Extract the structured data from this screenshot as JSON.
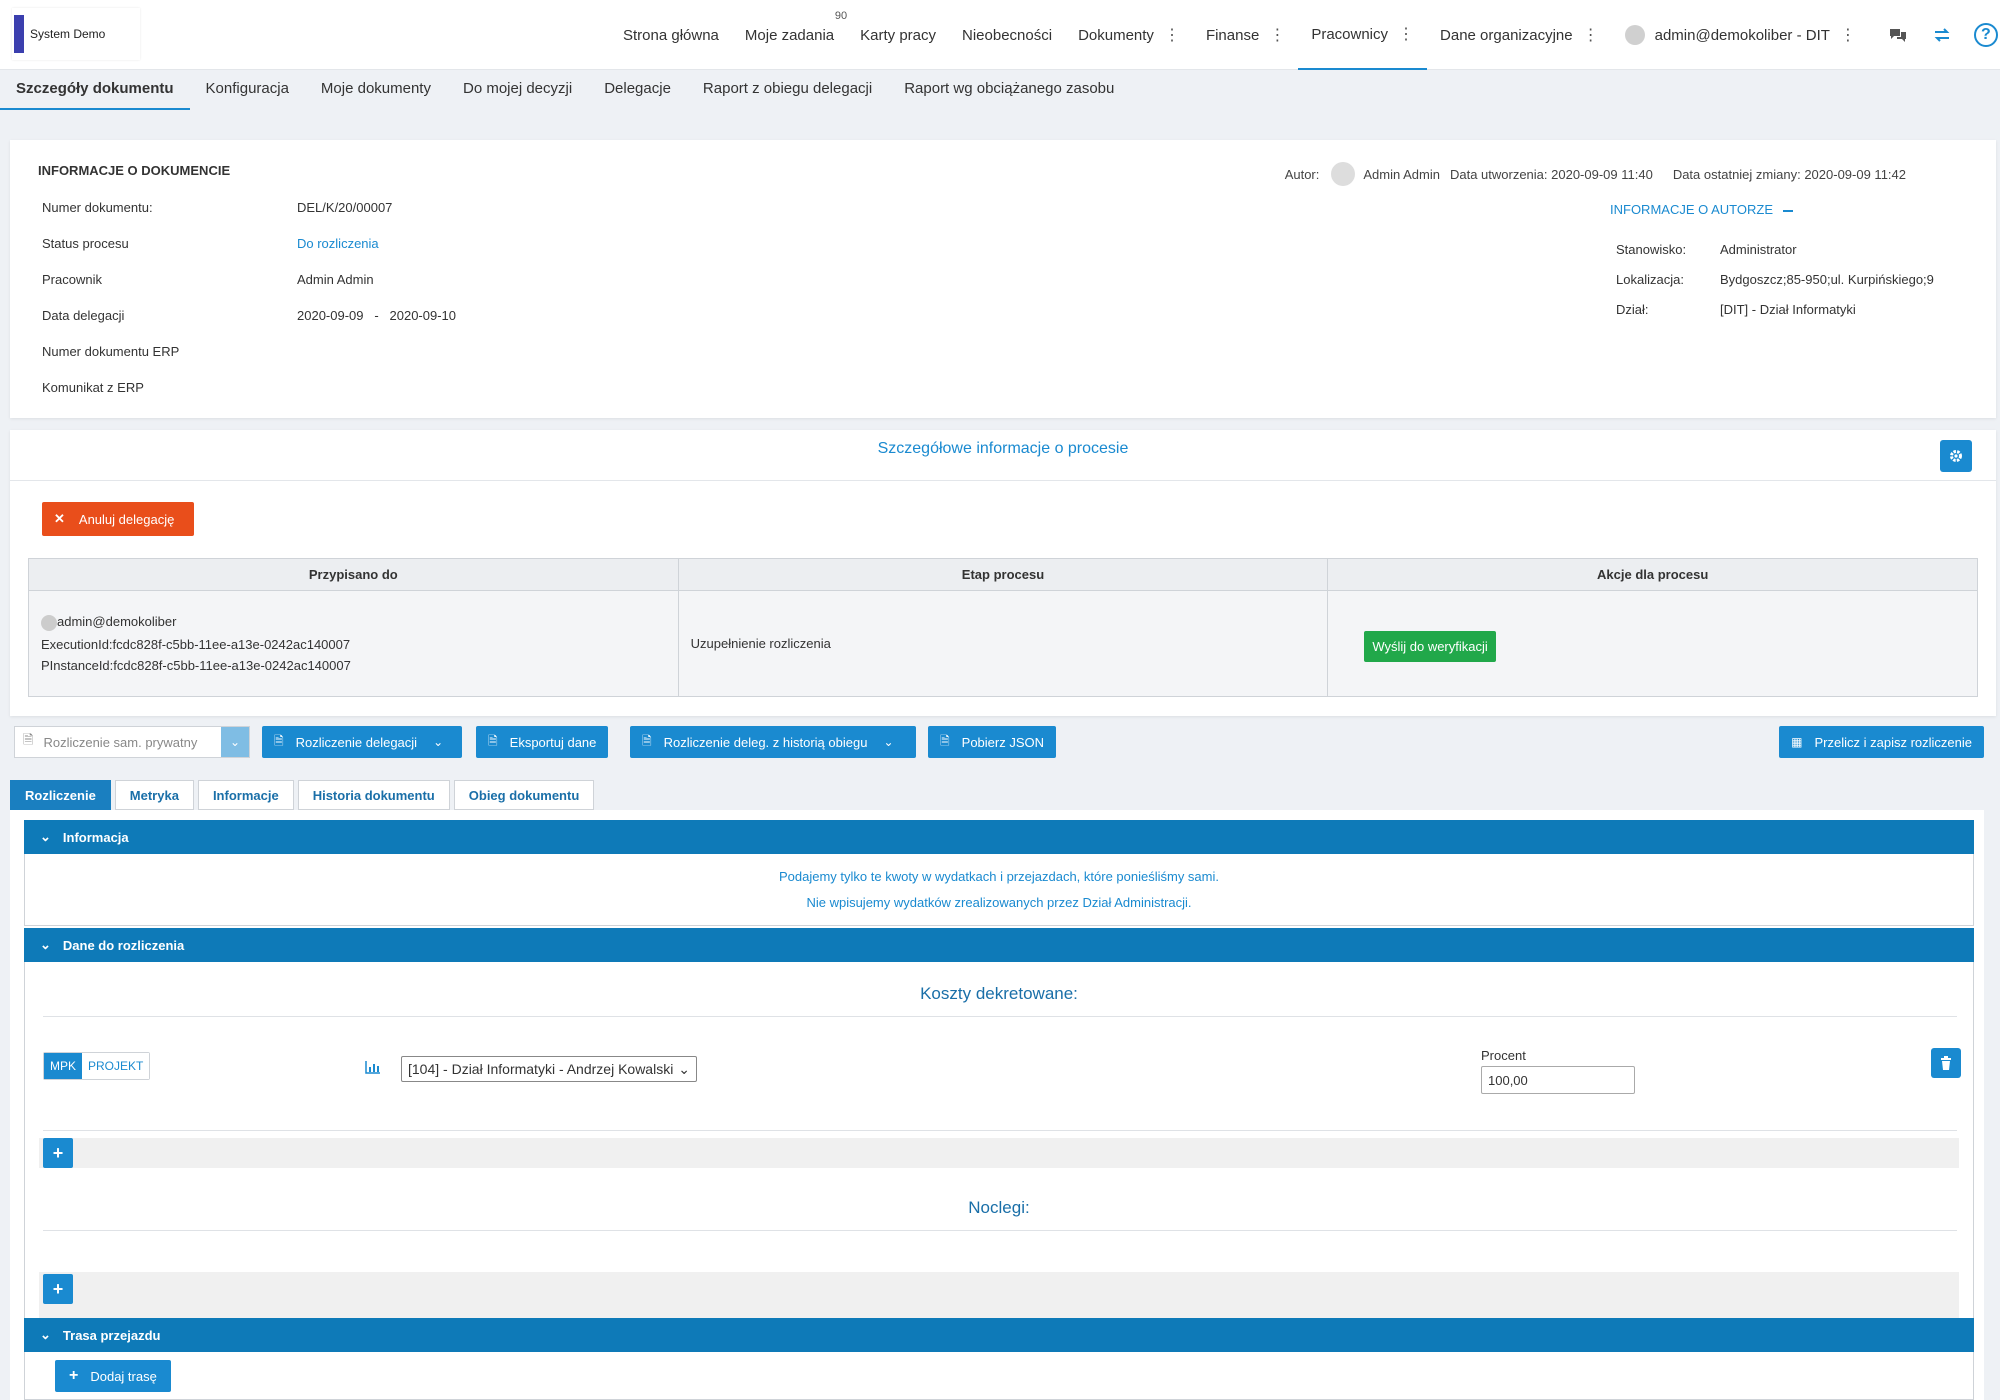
{
  "app": {
    "logo_text": "System Demo"
  },
  "nav": {
    "items": [
      {
        "label": "Strona główna",
        "dots": false
      },
      {
        "label": "Moje zadania",
        "dots": false,
        "badge": "90"
      },
      {
        "label": "Karty pracy",
        "dots": false
      },
      {
        "label": "Nieobecności",
        "dots": false
      },
      {
        "label": "Dokumenty",
        "dots": true
      },
      {
        "label": "Finanse",
        "dots": true
      },
      {
        "label": "Pracownicy",
        "dots": true,
        "active": true
      },
      {
        "label": "Dane organizacyjne",
        "dots": true
      }
    ],
    "user": "admin@demokoliber - DIT",
    "dots": "⋮"
  },
  "subtabs": [
    "Szczegóły dokumentu",
    "Konfiguracja",
    "Moje dokumenty",
    "Do mojej decyzji",
    "Delegacje",
    "Raport z obiegu delegacji",
    "Raport wg obciążanego zasobu"
  ],
  "doc_info": {
    "title": "INFORMACJE O DOKUMENCIE",
    "author_label": "Autor:",
    "author_name": "Admin Admin",
    "created": "Data utworzenia: 2020-09-09 11:40",
    "modified": "Data ostatniej zmiany: 2020-09-09 11:42",
    "rows": [
      {
        "label": "Numer dokumentu:",
        "value": "DEL/K/20/00007"
      },
      {
        "label": "Status procesu",
        "value": "Do rozliczenia"
      },
      {
        "label": "Pracownik",
        "value": "Admin Admin"
      },
      {
        "label": "Data delegacji",
        "value": "2020-09-09   -   2020-09-10"
      },
      {
        "label": "Numer dokumentu ERP",
        "value": ""
      },
      {
        "label": "Komunikat z ERP",
        "value": ""
      }
    ],
    "author_info_toggle": "INFORMACJE O AUTORZE",
    "author_details": [
      {
        "label": "Stanowisko:",
        "value": "Administrator"
      },
      {
        "label": "Lokalizacja:",
        "value": "Bydgoszcz;85-950;ul. Kurpińskiego;9"
      },
      {
        "label": "Dział:",
        "value": "[DIT] - Dział Informatyki"
      }
    ]
  },
  "process": {
    "title": "Szczegółowe informacje o procesie",
    "cancel_label": "Anuluj delegację",
    "headers": [
      "Przypisano do",
      "Etap procesu",
      "Akcje dla procesu"
    ],
    "assigned_user": "admin@demokoliber",
    "execution_id": "ExecutionId:fcdc828f-c5bb-11ee-a13e-0242ac140007",
    "pinstance_id": "PInstanceId:fcdc828f-c5bb-11ee-a13e-0242ac140007",
    "stage": "Uzupełnienie rozliczenia",
    "action_label": "Wyślij do weryfikacji"
  },
  "toolbar": {
    "select_value": "Rozliczenie sam. prywatny",
    "btn_settlement": "Rozliczenie delegacji",
    "btn_export": "Eksportuj dane",
    "btn_history": "Rozliczenie deleg. z historią obiegu",
    "btn_json": "Pobierz JSON",
    "btn_recalc": "Przelicz i zapisz rozliczenie"
  },
  "tabs": [
    "Rozliczenie",
    "Metryka",
    "Informacje",
    "Historia dokumentu",
    "Obieg dokumentu"
  ],
  "panels": {
    "info_title": "Informacja",
    "info_line1": "Podajemy tylko te kwoty w wydatkach i przejazdach, które ponieśliśmy sami.",
    "info_line2": "Nie wpisujemy wydatków zrealizowanych przez Dział Administracji.",
    "data_title": "Dane do rozliczenia",
    "costs_title": "Koszty dekretowane:",
    "toggle_mpk": "MPK",
    "toggle_project": "PROJEKT",
    "mpk_select": "[104] - Dział Informatyki - Andrzej Kowalski",
    "percent_label": "Procent",
    "percent_value": "100,00",
    "nights_title": "Noclegi:",
    "route_title": "Trasa przejazdu",
    "add_route": "Dodaj trasę"
  }
}
